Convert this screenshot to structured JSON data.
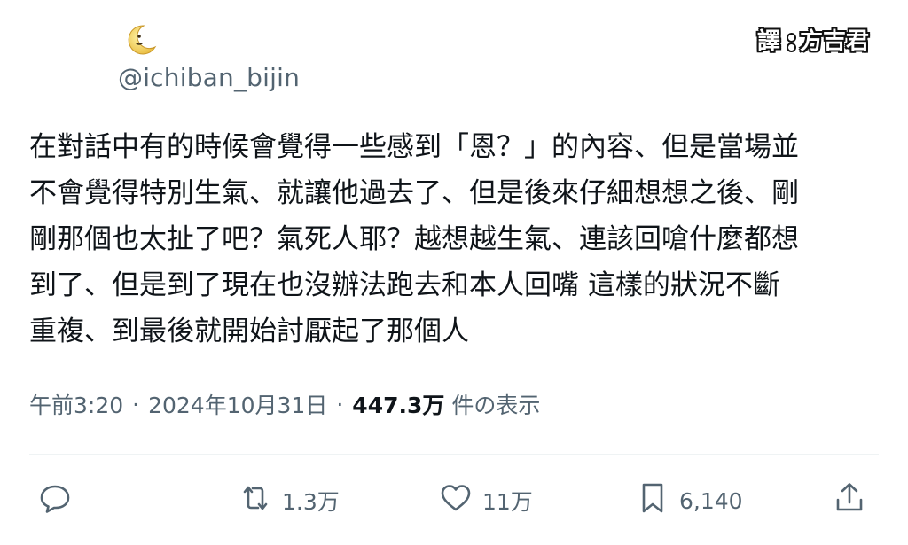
{
  "author": {
    "handle": "@ichiban_bijin",
    "avatar_icon": "crescent-moon-emoji-icon"
  },
  "translator_badge": {
    "left": "譯",
    "right": "方吉君"
  },
  "tweet": {
    "lines": [
      "在對話中有的時候會覺得一些感到「恩？」的內容、但是當場並",
      "不會覺得特別生氣、就讓他過去了、但是後來仔細想想之後、剛",
      "剛那個也太扯了吧？氣死人耶？越想越生氣、連該回嗆什麼都想",
      "到了、但是到了現在也沒辦法跑去和本人回嘴 這樣的狀況不斷",
      "重複、到最後就開始討厭起了那個人"
    ]
  },
  "meta": {
    "time": "午前3:20",
    "separator": "·",
    "date": "2024年10月31日",
    "views": "447.3万",
    "views_label": "件の表示"
  },
  "actions": {
    "reply": {
      "icon": "reply-bubble-icon",
      "count": ""
    },
    "retweet": {
      "icon": "retweet-icon",
      "count": "1.3万"
    },
    "like": {
      "icon": "heart-icon",
      "count": "11万"
    },
    "bookmark": {
      "icon": "bookmark-icon",
      "count": "6,140"
    },
    "share": {
      "icon": "share-icon",
      "count": ""
    }
  },
  "colors": {
    "text_primary": "#0f1419",
    "text_secondary": "#536471",
    "divider": "#eff3f4",
    "background": "#ffffff"
  }
}
